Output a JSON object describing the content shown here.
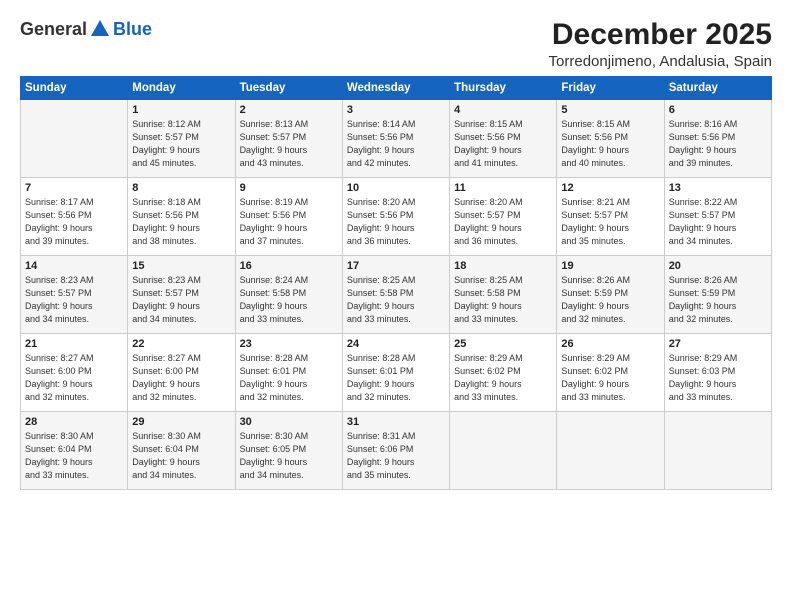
{
  "logo": {
    "general": "General",
    "blue": "Blue"
  },
  "title": "December 2025",
  "location": "Torredonjimeno, Andalusia, Spain",
  "days_of_week": [
    "Sunday",
    "Monday",
    "Tuesday",
    "Wednesday",
    "Thursday",
    "Friday",
    "Saturday"
  ],
  "weeks": [
    [
      {
        "day": "",
        "info": ""
      },
      {
        "day": "1",
        "info": "Sunrise: 8:12 AM\nSunset: 5:57 PM\nDaylight: 9 hours\nand 45 minutes."
      },
      {
        "day": "2",
        "info": "Sunrise: 8:13 AM\nSunset: 5:57 PM\nDaylight: 9 hours\nand 43 minutes."
      },
      {
        "day": "3",
        "info": "Sunrise: 8:14 AM\nSunset: 5:56 PM\nDaylight: 9 hours\nand 42 minutes."
      },
      {
        "day": "4",
        "info": "Sunrise: 8:15 AM\nSunset: 5:56 PM\nDaylight: 9 hours\nand 41 minutes."
      },
      {
        "day": "5",
        "info": "Sunrise: 8:15 AM\nSunset: 5:56 PM\nDaylight: 9 hours\nand 40 minutes."
      },
      {
        "day": "6",
        "info": "Sunrise: 8:16 AM\nSunset: 5:56 PM\nDaylight: 9 hours\nand 39 minutes."
      }
    ],
    [
      {
        "day": "7",
        "info": "Sunrise: 8:17 AM\nSunset: 5:56 PM\nDaylight: 9 hours\nand 39 minutes."
      },
      {
        "day": "8",
        "info": "Sunrise: 8:18 AM\nSunset: 5:56 PM\nDaylight: 9 hours\nand 38 minutes."
      },
      {
        "day": "9",
        "info": "Sunrise: 8:19 AM\nSunset: 5:56 PM\nDaylight: 9 hours\nand 37 minutes."
      },
      {
        "day": "10",
        "info": "Sunrise: 8:20 AM\nSunset: 5:56 PM\nDaylight: 9 hours\nand 36 minutes."
      },
      {
        "day": "11",
        "info": "Sunrise: 8:20 AM\nSunset: 5:57 PM\nDaylight: 9 hours\nand 36 minutes."
      },
      {
        "day": "12",
        "info": "Sunrise: 8:21 AM\nSunset: 5:57 PM\nDaylight: 9 hours\nand 35 minutes."
      },
      {
        "day": "13",
        "info": "Sunrise: 8:22 AM\nSunset: 5:57 PM\nDaylight: 9 hours\nand 34 minutes."
      }
    ],
    [
      {
        "day": "14",
        "info": "Sunrise: 8:23 AM\nSunset: 5:57 PM\nDaylight: 9 hours\nand 34 minutes."
      },
      {
        "day": "15",
        "info": "Sunrise: 8:23 AM\nSunset: 5:57 PM\nDaylight: 9 hours\nand 34 minutes."
      },
      {
        "day": "16",
        "info": "Sunrise: 8:24 AM\nSunset: 5:58 PM\nDaylight: 9 hours\nand 33 minutes."
      },
      {
        "day": "17",
        "info": "Sunrise: 8:25 AM\nSunset: 5:58 PM\nDaylight: 9 hours\nand 33 minutes."
      },
      {
        "day": "18",
        "info": "Sunrise: 8:25 AM\nSunset: 5:58 PM\nDaylight: 9 hours\nand 33 minutes."
      },
      {
        "day": "19",
        "info": "Sunrise: 8:26 AM\nSunset: 5:59 PM\nDaylight: 9 hours\nand 32 minutes."
      },
      {
        "day": "20",
        "info": "Sunrise: 8:26 AM\nSunset: 5:59 PM\nDaylight: 9 hours\nand 32 minutes."
      }
    ],
    [
      {
        "day": "21",
        "info": "Sunrise: 8:27 AM\nSunset: 6:00 PM\nDaylight: 9 hours\nand 32 minutes."
      },
      {
        "day": "22",
        "info": "Sunrise: 8:27 AM\nSunset: 6:00 PM\nDaylight: 9 hours\nand 32 minutes."
      },
      {
        "day": "23",
        "info": "Sunrise: 8:28 AM\nSunset: 6:01 PM\nDaylight: 9 hours\nand 32 minutes."
      },
      {
        "day": "24",
        "info": "Sunrise: 8:28 AM\nSunset: 6:01 PM\nDaylight: 9 hours\nand 32 minutes."
      },
      {
        "day": "25",
        "info": "Sunrise: 8:29 AM\nSunset: 6:02 PM\nDaylight: 9 hours\nand 33 minutes."
      },
      {
        "day": "26",
        "info": "Sunrise: 8:29 AM\nSunset: 6:02 PM\nDaylight: 9 hours\nand 33 minutes."
      },
      {
        "day": "27",
        "info": "Sunrise: 8:29 AM\nSunset: 6:03 PM\nDaylight: 9 hours\nand 33 minutes."
      }
    ],
    [
      {
        "day": "28",
        "info": "Sunrise: 8:30 AM\nSunset: 6:04 PM\nDaylight: 9 hours\nand 33 minutes."
      },
      {
        "day": "29",
        "info": "Sunrise: 8:30 AM\nSunset: 6:04 PM\nDaylight: 9 hours\nand 34 minutes."
      },
      {
        "day": "30",
        "info": "Sunrise: 8:30 AM\nSunset: 6:05 PM\nDaylight: 9 hours\nand 34 minutes."
      },
      {
        "day": "31",
        "info": "Sunrise: 8:31 AM\nSunset: 6:06 PM\nDaylight: 9 hours\nand 35 minutes."
      },
      {
        "day": "",
        "info": ""
      },
      {
        "day": "",
        "info": ""
      },
      {
        "day": "",
        "info": ""
      }
    ]
  ]
}
